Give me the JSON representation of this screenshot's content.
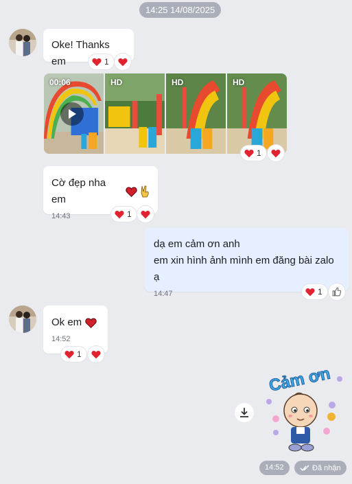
{
  "date_separator": "14:25 14/08/2025",
  "messages": [
    {
      "text": "Oke! Thanks em",
      "react_count": "1"
    },
    {
      "video_duration": "00:06",
      "hd_label": "HD",
      "react_count": "1"
    },
    {
      "text": "Cờ đẹp nha em",
      "time": "14:43",
      "react_count": "1"
    },
    {
      "line1": "dạ em cảm ơn anh",
      "line2": "em xin hình ảnh mình em đăng bài zalo ạ",
      "time": "14:47",
      "react_count": "1"
    },
    {
      "text": "Ok em",
      "time": "14:52",
      "react_count": "1"
    }
  ],
  "sticker": {
    "text": "Cảm ơn",
    "time": "14:52",
    "status": "Đã nhận"
  },
  "colors": {
    "heart": "#e1232f",
    "mine_bubble": "#e5efff",
    "background": "#eaebef"
  }
}
